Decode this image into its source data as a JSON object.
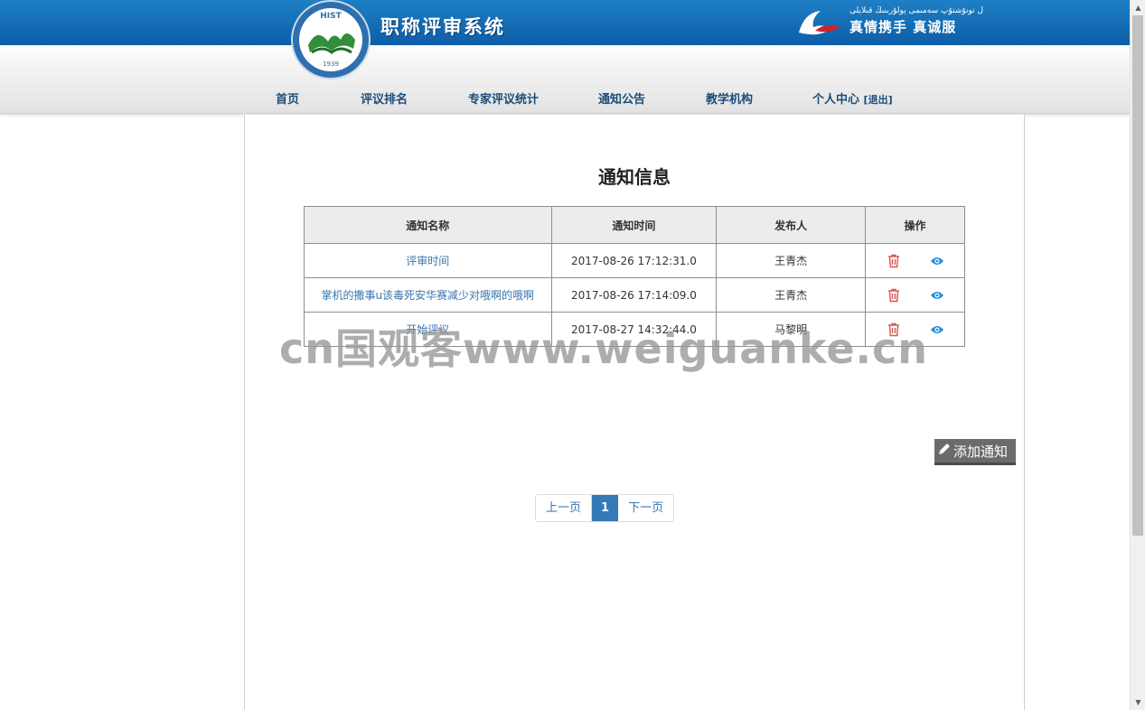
{
  "header": {
    "system_title": "职称评审系统",
    "logo_text": "HIST",
    "logo_year": "1939",
    "slogan_script": "ل تونۇشتۇپ سەمىمى يولۇرىنىڭ قىلايلى",
    "slogan": "真情携手 真诚服"
  },
  "nav": {
    "items": [
      "首页",
      "评议排名",
      "专家评议统计",
      "通知公告",
      "教学机构",
      "个人中心"
    ],
    "logout": "[退出]"
  },
  "main": {
    "title": "通知信息",
    "table": {
      "headers": [
        "通知名称",
        "通知时间",
        "发布人",
        "操作"
      ],
      "rows": [
        {
          "name": "评审时间",
          "time": "2017-08-26 17:12:31.0",
          "publisher": "王青杰"
        },
        {
          "name": "掌机的撒事u该毒死安华赛减少对哦啊的哦啊",
          "time": "2017-08-26 17:14:09.0",
          "publisher": "王青杰"
        },
        {
          "name": "开始评议",
          "time": "2017-08-27 14:32:44.0",
          "publisher": "马黎明"
        }
      ]
    },
    "add_button": "添加通知",
    "pager": {
      "prev": "上一页",
      "current": "1",
      "next": "下一页"
    }
  },
  "watermark": "cn国观客www.weiguanke.cn",
  "colors": {
    "header_blue": "#0d5ea8",
    "link": "#3a74ad",
    "delete_icon": "#d9534f",
    "view_icon": "#1e90d6",
    "pager_active": "#337ab7"
  },
  "icons": {
    "delete": "trash-icon",
    "view": "eye-icon",
    "add": "pencil-icon"
  }
}
